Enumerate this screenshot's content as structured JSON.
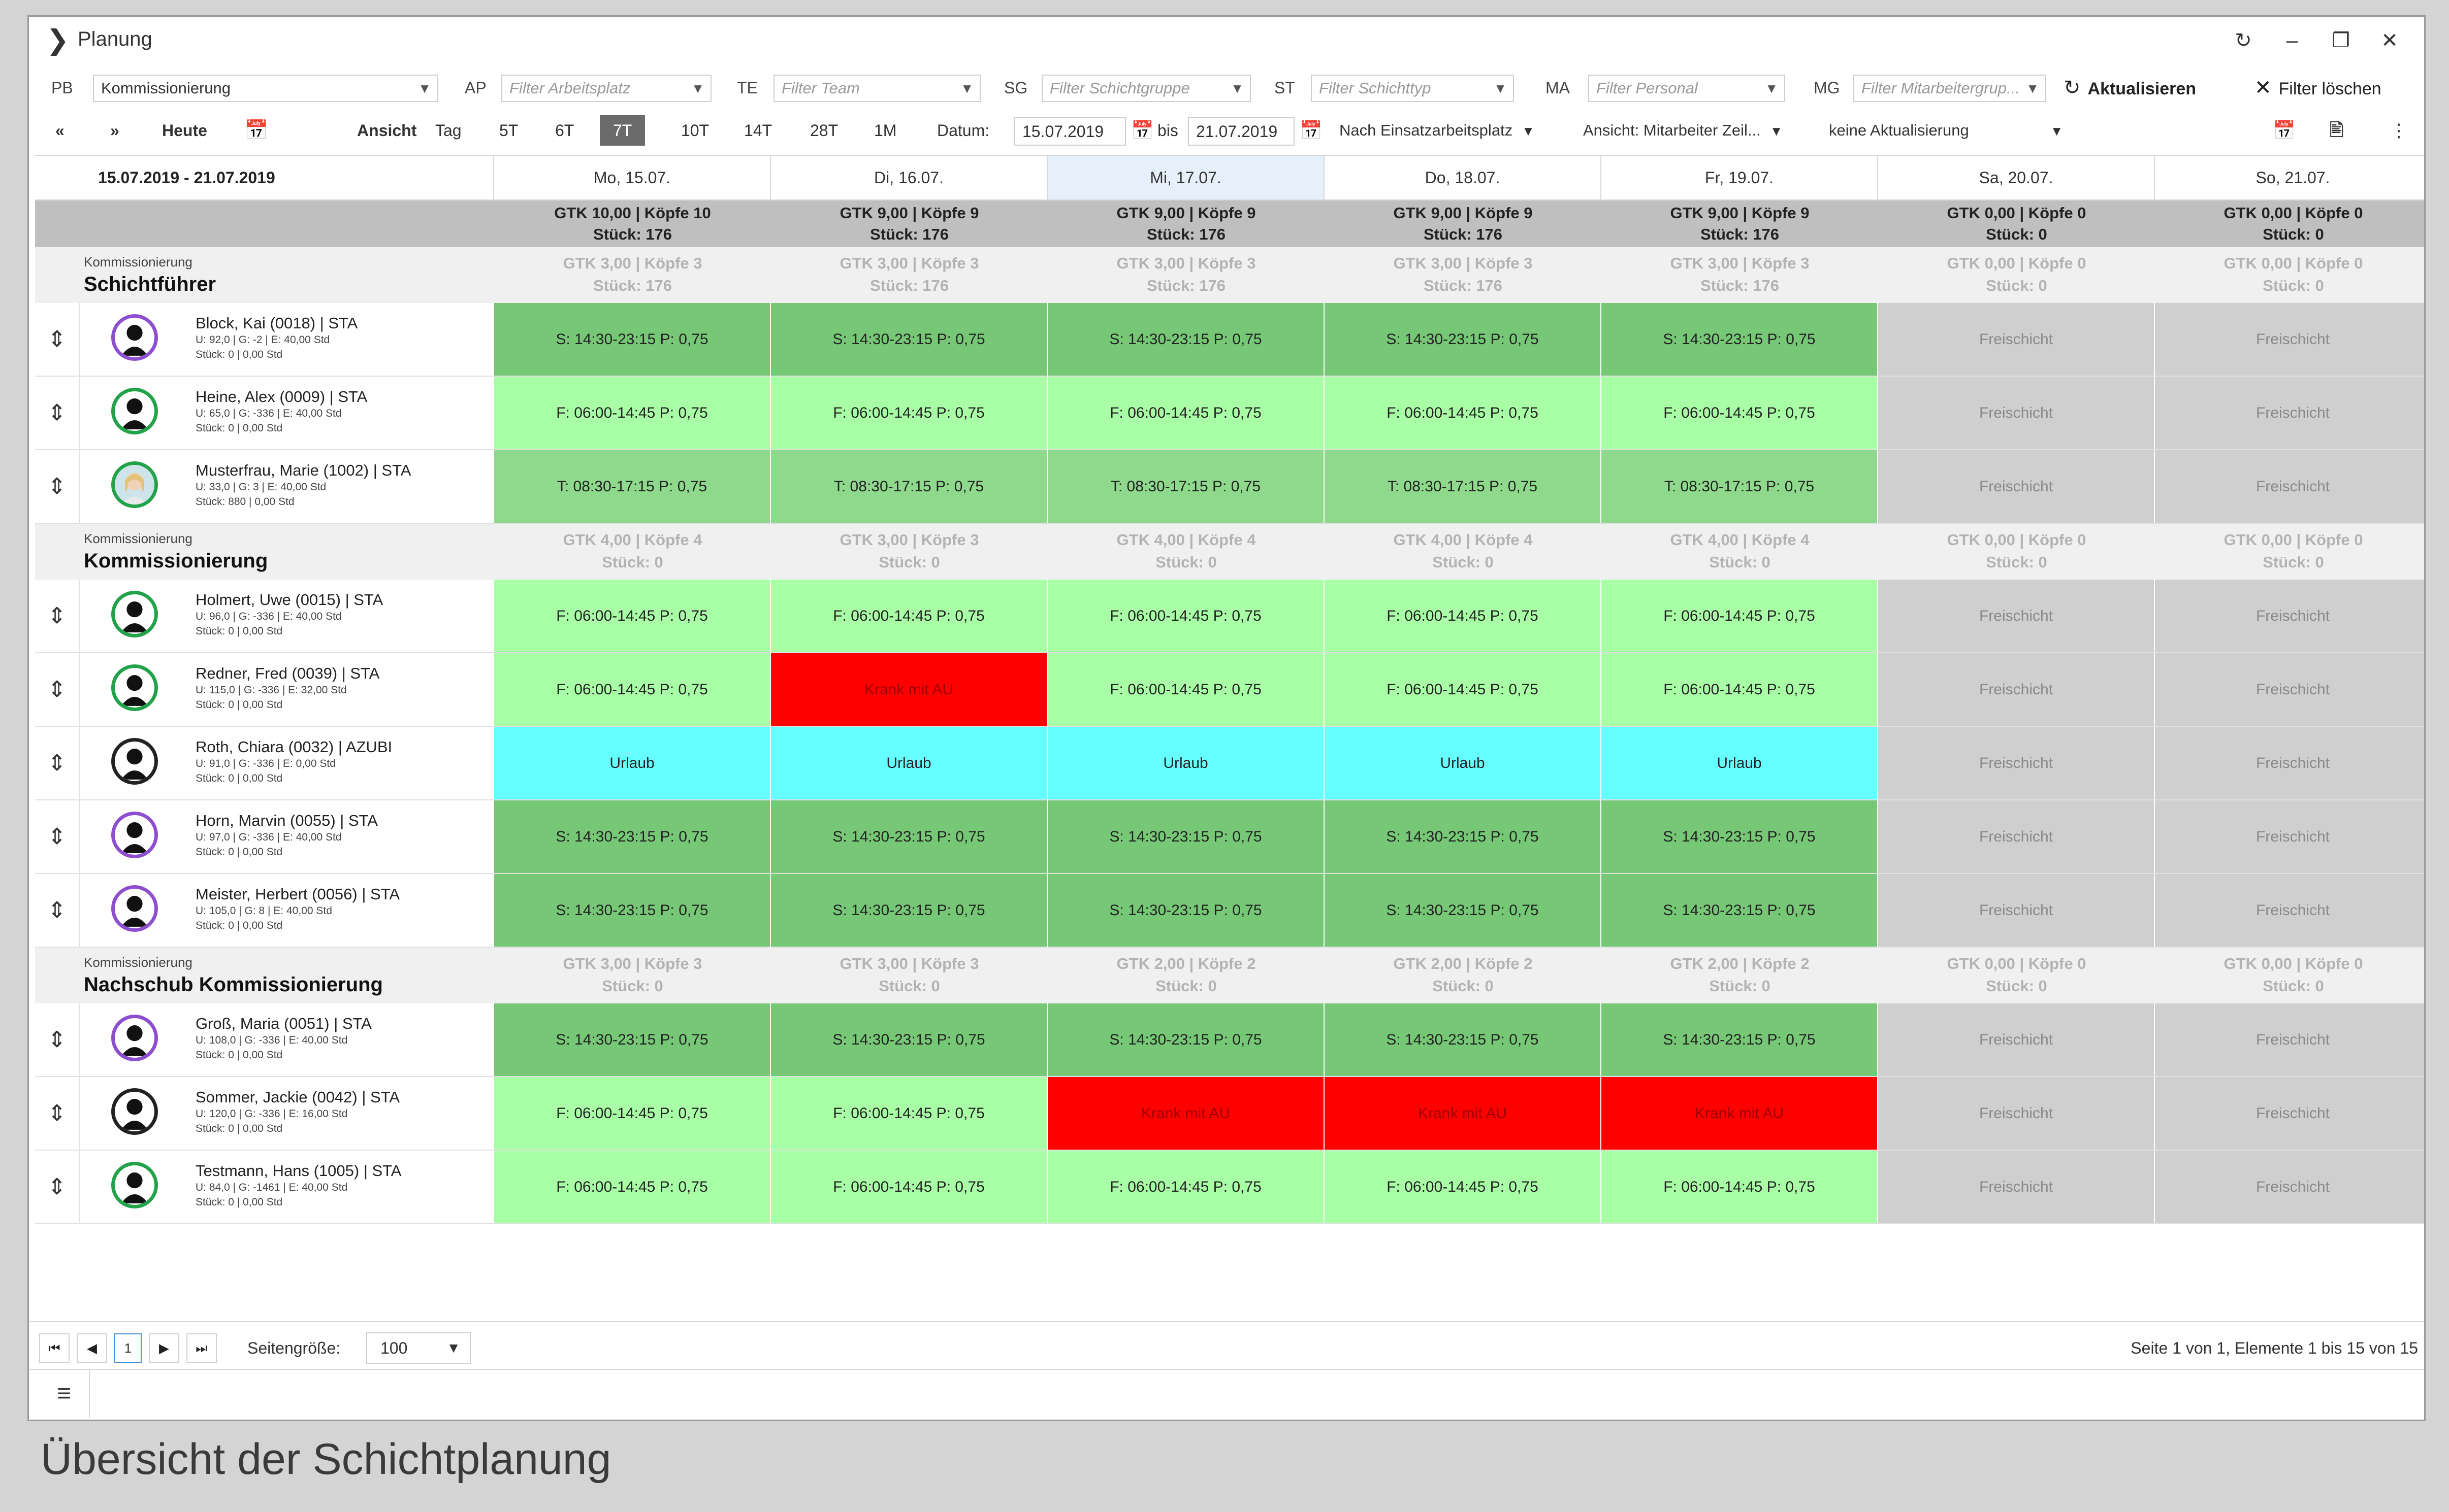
{
  "window": {
    "title": "Planung",
    "controls": [
      "↻",
      "–",
      "❐",
      "✕"
    ]
  },
  "filters": {
    "pb_label": "PB",
    "pb_value": "Kommissionierung",
    "ap_label": "AP",
    "ap_placeholder": "Filter Arbeitsplatz",
    "te_label": "TE",
    "te_placeholder": "Filter Team",
    "sg_label": "SG",
    "sg_placeholder": "Filter Schichtgruppe",
    "st_label": "ST",
    "st_placeholder": "Filter Schichttyp",
    "ma_label": "MA",
    "ma_placeholder": "Filter Personal",
    "mg_label": "MG",
    "mg_placeholder": "Filter Mitarbeitergrup...",
    "refresh_label": "Aktualisieren",
    "clear_label": "Filter löschen"
  },
  "toolbar": {
    "prev": "«",
    "next": "»",
    "today": "Heute",
    "view_label": "Ansicht",
    "ranges": [
      "Tag",
      "5T",
      "6T",
      "7T",
      "10T",
      "14T",
      "28T",
      "1M"
    ],
    "active_range": "7T",
    "date_label": "Datum:",
    "date_from": "15.07.2019",
    "bis_label": "bis",
    "date_to": "21.07.2019",
    "grouping": "Nach Einsatzarbeitsplatz",
    "view_mode": "Ansicht: Mitarbeiter Zeil...",
    "update_mode": "keine Aktualisierung"
  },
  "grid": {
    "range": "15.07.2019 - 21.07.2019",
    "days": [
      "Mo, 15.07.",
      "Di, 16.07.",
      "Mi, 17.07.",
      "Do, 18.07.",
      "Fr, 19.07.",
      "Sa, 20.07.",
      "So, 21.07."
    ],
    "totals": [
      [
        "GTK 10,00 | Köpfe 10",
        "Stück: 176"
      ],
      [
        "GTK 9,00 | Köpfe 9",
        "Stück: 176"
      ],
      [
        "GTK 9,00 | Köpfe 9",
        "Stück: 176"
      ],
      [
        "GTK 9,00 | Köpfe 9",
        "Stück: 176"
      ],
      [
        "GTK 9,00 | Köpfe 9",
        "Stück: 176"
      ],
      [
        "GTK 0,00 | Köpfe 0",
        "Stück: 0"
      ],
      [
        "GTK 0,00 | Köpfe 0",
        "Stück: 0"
      ]
    ],
    "groups": [
      {
        "small": "Kommissionierung",
        "name": "Schichtführer",
        "totals": [
          [
            "GTK 3,00 | Köpfe 3",
            "Stück: 176"
          ],
          [
            "GTK 3,00 | Köpfe 3",
            "Stück: 176"
          ],
          [
            "GTK 3,00 | Köpfe 3",
            "Stück: 176"
          ],
          [
            "GTK 3,00 | Köpfe 3",
            "Stück: 176"
          ],
          [
            "GTK 3,00 | Köpfe 3",
            "Stück: 176"
          ],
          [
            "GTK 0,00 | Köpfe 0",
            "Stück: 0"
          ],
          [
            "GTK 0,00 | Köpfe 0",
            "Stück: 0"
          ]
        ],
        "employees": [
          {
            "name": "Block, Kai (0018) | STA",
            "sub1": "U: 92,0 | G: -2 | E: 40,00 Std",
            "sub2": "Stück: 0 | 0,00 Std",
            "ring": "purple",
            "cells": [
              [
                "dark",
                "S: 14:30-23:15 P: 0,75"
              ],
              [
                "dark",
                "S: 14:30-23:15 P: 0,75"
              ],
              [
                "dark",
                "S: 14:30-23:15 P: 0,75"
              ],
              [
                "dark",
                "S: 14:30-23:15 P: 0,75"
              ],
              [
                "dark",
                "S: 14:30-23:15 P: 0,75"
              ],
              [
                "frei",
                "Freischicht"
              ],
              [
                "frei",
                "Freischicht"
              ]
            ]
          },
          {
            "name": "Heine, Alex (0009) | STA",
            "sub1": "U: 65,0 | G: -336 | E: 40,00 Std",
            "sub2": "Stück: 0 | 0,00 Std",
            "ring": "green",
            "cells": [
              [
                "light",
                "F: 06:00-14:45 P: 0,75"
              ],
              [
                "light",
                "F: 06:00-14:45 P: 0,75"
              ],
              [
                "light",
                "F: 06:00-14:45 P: 0,75"
              ],
              [
                "light",
                "F: 06:00-14:45 P: 0,75"
              ],
              [
                "light",
                "F: 06:00-14:45 P: 0,75"
              ],
              [
                "frei",
                "Freischicht"
              ],
              [
                "frei",
                "Freischicht"
              ]
            ]
          },
          {
            "name": "Musterfrau, Marie (1002) | STA",
            "sub1": "U: 33,0 | G: 3 | E: 40,00 Std",
            "sub2": "Stück: 880 | 0,00 Std",
            "ring": "photo",
            "cells": [
              [
                "mid",
                "T: 08:30-17:15 P: 0,75"
              ],
              [
                "mid",
                "T: 08:30-17:15 P: 0,75"
              ],
              [
                "mid",
                "T: 08:30-17:15 P: 0,75"
              ],
              [
                "mid",
                "T: 08:30-17:15 P: 0,75"
              ],
              [
                "mid",
                "T: 08:30-17:15 P: 0,75"
              ],
              [
                "frei",
                "Freischicht"
              ],
              [
                "frei",
                "Freischicht"
              ]
            ]
          }
        ]
      },
      {
        "small": "Kommissionierung",
        "name": "Kommissionierung",
        "totals": [
          [
            "GTK 4,00 | Köpfe 4",
            "Stück: 0"
          ],
          [
            "GTK 3,00 | Köpfe 3",
            "Stück: 0"
          ],
          [
            "GTK 4,00 | Köpfe 4",
            "Stück: 0"
          ],
          [
            "GTK 4,00 | Köpfe 4",
            "Stück: 0"
          ],
          [
            "GTK 4,00 | Köpfe 4",
            "Stück: 0"
          ],
          [
            "GTK 0,00 | Köpfe 0",
            "Stück: 0"
          ],
          [
            "GTK 0,00 | Köpfe 0",
            "Stück: 0"
          ]
        ],
        "employees": [
          {
            "name": "Holmert, Uwe (0015) | STA",
            "sub1": "U: 96,0 | G: -336 | E: 40,00 Std",
            "sub2": "Stück: 0 | 0,00 Std",
            "ring": "green",
            "cells": [
              [
                "light",
                "F: 06:00-14:45 P: 0,75"
              ],
              [
                "light",
                "F: 06:00-14:45 P: 0,75"
              ],
              [
                "light",
                "F: 06:00-14:45 P: 0,75"
              ],
              [
                "light",
                "F: 06:00-14:45 P: 0,75"
              ],
              [
                "light",
                "F: 06:00-14:45 P: 0,75"
              ],
              [
                "frei",
                "Freischicht"
              ],
              [
                "frei",
                "Freischicht"
              ]
            ]
          },
          {
            "name": "Redner, Fred (0039) | STA",
            "sub1": "U: 115,0 | G: -336 | E: 32,00 Std",
            "sub2": "Stück: 0 | 0,00 Std",
            "ring": "green",
            "cells": [
              [
                "light",
                "F: 06:00-14:45 P: 0,75"
              ],
              [
                "krank",
                "Krank mit AU"
              ],
              [
                "light",
                "F: 06:00-14:45 P: 0,75"
              ],
              [
                "light",
                "F: 06:00-14:45 P: 0,75"
              ],
              [
                "light",
                "F: 06:00-14:45 P: 0,75"
              ],
              [
                "frei",
                "Freischicht"
              ],
              [
                "frei",
                "Freischicht"
              ]
            ]
          },
          {
            "name": "Roth, Chiara (0032) | AZUBI",
            "sub1": "U: 91,0 | G: -336 | E: 0,00 Std",
            "sub2": "Stück: 0 | 0,00 Std",
            "ring": "dark",
            "cells": [
              [
                "urlaub",
                "Urlaub"
              ],
              [
                "urlaub",
                "Urlaub"
              ],
              [
                "urlaub",
                "Urlaub"
              ],
              [
                "urlaub",
                "Urlaub"
              ],
              [
                "urlaub",
                "Urlaub"
              ],
              [
                "frei",
                "Freischicht"
              ],
              [
                "frei",
                "Freischicht"
              ]
            ]
          },
          {
            "name": "Horn, Marvin (0055) | STA",
            "sub1": "U: 97,0 | G: -336 | E: 40,00 Std",
            "sub2": "Stück: 0 | 0,00 Std",
            "ring": "purple",
            "cells": [
              [
                "dark",
                "S: 14:30-23:15 P: 0,75"
              ],
              [
                "dark",
                "S: 14:30-23:15 P: 0,75"
              ],
              [
                "dark",
                "S: 14:30-23:15 P: 0,75"
              ],
              [
                "dark",
                "S: 14:30-23:15 P: 0,75"
              ],
              [
                "dark",
                "S: 14:30-23:15 P: 0,75"
              ],
              [
                "frei",
                "Freischicht"
              ],
              [
                "frei",
                "Freischicht"
              ]
            ]
          },
          {
            "name": "Meister, Herbert (0056) | STA",
            "sub1": "U: 105,0 | G: 8 | E: 40,00 Std",
            "sub2": "Stück: 0 | 0,00 Std",
            "ring": "purple",
            "cells": [
              [
                "dark",
                "S: 14:30-23:15 P: 0,75"
              ],
              [
                "dark",
                "S: 14:30-23:15 P: 0,75"
              ],
              [
                "dark",
                "S: 14:30-23:15 P: 0,75"
              ],
              [
                "dark",
                "S: 14:30-23:15 P: 0,75"
              ],
              [
                "dark",
                "S: 14:30-23:15 P: 0,75"
              ],
              [
                "frei",
                "Freischicht"
              ],
              [
                "frei",
                "Freischicht"
              ]
            ]
          }
        ]
      },
      {
        "small": "Kommissionierung",
        "name": "Nachschub Kommissionierung",
        "totals": [
          [
            "GTK 3,00 | Köpfe 3",
            "Stück: 0"
          ],
          [
            "GTK 3,00 | Köpfe 3",
            "Stück: 0"
          ],
          [
            "GTK 2,00 | Köpfe 2",
            "Stück: 0"
          ],
          [
            "GTK 2,00 | Köpfe 2",
            "Stück: 0"
          ],
          [
            "GTK 2,00 | Köpfe 2",
            "Stück: 0"
          ],
          [
            "GTK 0,00 | Köpfe 0",
            "Stück: 0"
          ],
          [
            "GTK 0,00 | Köpfe 0",
            "Stück: 0"
          ]
        ],
        "employees": [
          {
            "name": "Groß, Maria (0051) | STA",
            "sub1": "U: 108,0 | G: -336 | E: 40,00 Std",
            "sub2": "Stück: 0 | 0,00 Std",
            "ring": "purple",
            "cells": [
              [
                "dark",
                "S: 14:30-23:15 P: 0,75"
              ],
              [
                "dark",
                "S: 14:30-23:15 P: 0,75"
              ],
              [
                "dark",
                "S: 14:30-23:15 P: 0,75"
              ],
              [
                "dark",
                "S: 14:30-23:15 P: 0,75"
              ],
              [
                "dark",
                "S: 14:30-23:15 P: 0,75"
              ],
              [
                "frei",
                "Freischicht"
              ],
              [
                "frei",
                "Freischicht"
              ]
            ]
          },
          {
            "name": "Sommer, Jackie (0042) | STA",
            "sub1": "U: 120,0 | G: -336 | E: 16,00 Std",
            "sub2": "Stück: 0 | 0,00 Std",
            "ring": "dark",
            "cells": [
              [
                "light",
                "F: 06:00-14:45 P: 0,75"
              ],
              [
                "light",
                "F: 06:00-14:45 P: 0,75"
              ],
              [
                "krank",
                "Krank mit AU"
              ],
              [
                "krank",
                "Krank mit AU"
              ],
              [
                "krank",
                "Krank mit AU"
              ],
              [
                "frei",
                "Freischicht"
              ],
              [
                "frei",
                "Freischicht"
              ]
            ]
          },
          {
            "name": "Testmann, Hans (1005) | STA",
            "sub1": "U: 84,0 | G: -1461 | E: 40,00 Std",
            "sub2": "Stück: 0 | 0,00 Std",
            "ring": "green",
            "cells": [
              [
                "light",
                "F: 06:00-14:45 P: 0,75"
              ],
              [
                "light",
                "F: 06:00-14:45 P: 0,75"
              ],
              [
                "light",
                "F: 06:00-14:45 P: 0,75"
              ],
              [
                "light",
                "F: 06:00-14:45 P: 0,75"
              ],
              [
                "light",
                "F: 06:00-14:45 P: 0,75"
              ],
              [
                "frei",
                "Freischicht"
              ],
              [
                "frei",
                "Freischicht"
              ]
            ]
          }
        ]
      }
    ]
  },
  "pager": {
    "current_page": "1",
    "size_label": "Seitengröße:",
    "size_value": "100",
    "info": "Seite 1 von 1, Elemente 1 bis 15 von 15"
  },
  "caption": "Übersicht der Schichtplanung"
}
